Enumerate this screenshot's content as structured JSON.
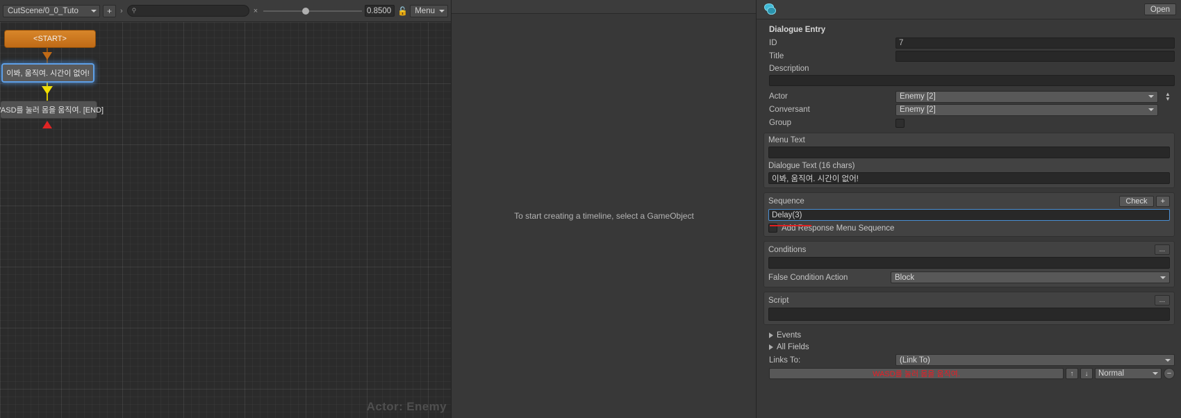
{
  "graph_toolbar": {
    "conversation_dropdown": "CutScene/0_0_Tuto",
    "add_button": "+",
    "breadcrumb_chevron": "›",
    "search_icon": "search-icon",
    "search_value": "",
    "search_clear": "×",
    "zoom_value": "0.8500",
    "lock_icon": "unlocked-padlock-icon",
    "menu_label": "Menu"
  },
  "graph": {
    "nodes": [
      {
        "label": "<START>",
        "type": "start"
      },
      {
        "label": "이봐, 움직여. 시간이 없어!",
        "type": "selected"
      },
      {
        "label": "WASD를 눌러 몸을 움직여. [END]",
        "type": "normal"
      }
    ],
    "watermark": "Actor: Enemy"
  },
  "timeline": {
    "message": "To start creating a timeline, select a GameObject"
  },
  "inspector": {
    "open_button": "Open",
    "database_icon": "dialogue-database-icon",
    "section_title": "Dialogue Entry",
    "id_label": "ID",
    "id_value": "7",
    "title_label": "Title",
    "title_value": "",
    "description_label": "Description",
    "description_value": "",
    "actor_label": "Actor",
    "actor_value": "Enemy [2]",
    "conversant_label": "Conversant",
    "conversant_value": "Enemy [2]",
    "group_label": "Group",
    "group_checked": false,
    "menu_text_label": "Menu Text",
    "menu_text_value": "",
    "dialogue_text_label": "Dialogue Text (16 chars)",
    "dialogue_text_value": "이봐, 움직여. 시간이 없어!",
    "sequence_label": "Sequence",
    "sequence_check_button": "Check",
    "sequence_plus_button": "+",
    "sequence_value": "Delay(3)",
    "add_response_menu_label": "Add Response Menu Sequence",
    "add_response_menu_checked": false,
    "conditions_label": "Conditions",
    "conditions_dots": "...",
    "conditions_value": "",
    "false_condition_action_label": "False Condition Action",
    "false_condition_action_value": "Block",
    "script_label": "Script",
    "script_dots": "...",
    "script_value": "",
    "events_label": "Events",
    "all_fields_label": "All Fields",
    "links_to_label": "Links To:",
    "links_to_value": "(Link To)",
    "link_entry_text": "WASD를 눌러 몸을 움직여.",
    "link_up_arrow": "↑",
    "link_down_arrow": "↓",
    "link_priority": "Normal",
    "link_remove": "−"
  },
  "colors": {
    "accent_blue": "#5ea0e8",
    "start_orange": "#c06a16",
    "annotation_red": "#e02020",
    "link_text_red": "#ec1c24"
  }
}
